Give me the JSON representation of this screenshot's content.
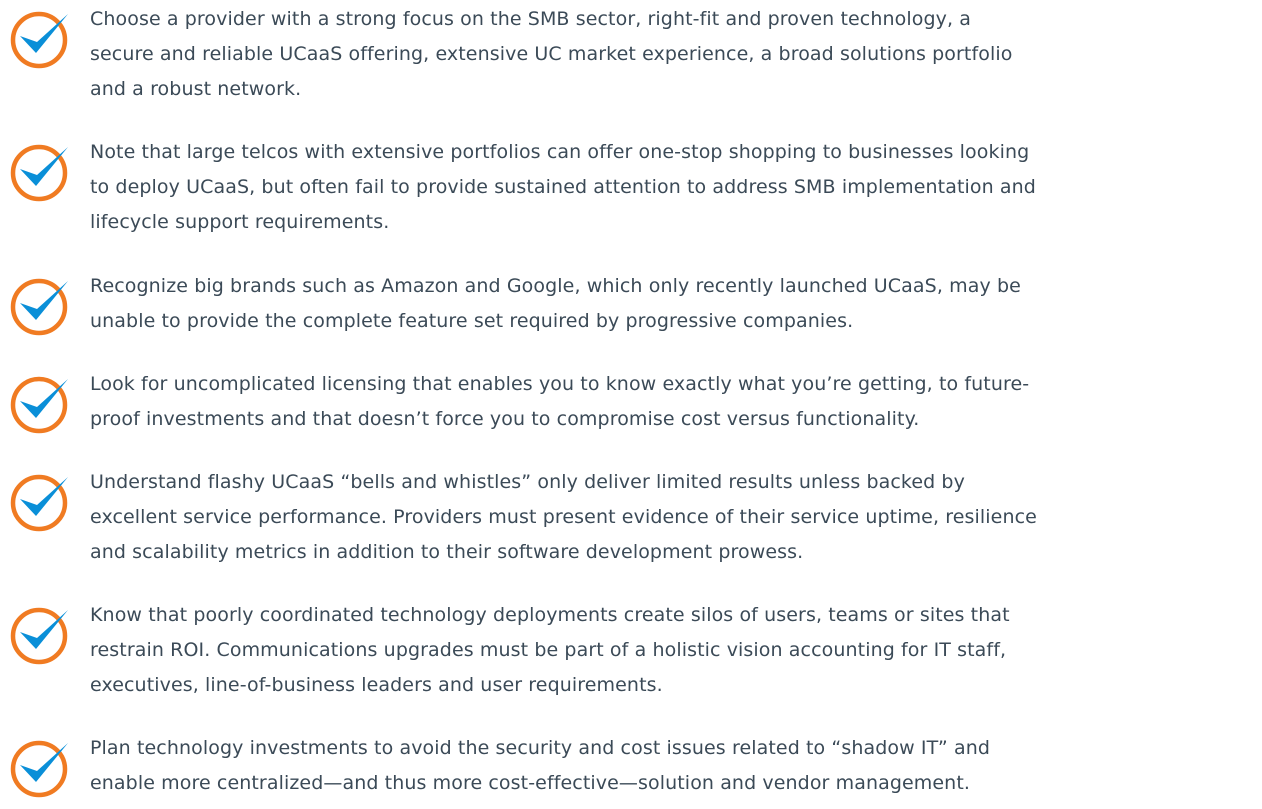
{
  "colors": {
    "circle": "#f07b22",
    "check": "#0a8fd8",
    "text": "#3b4a57"
  },
  "checklist": {
    "items": [
      {
        "icon": "checkmark-circle-icon",
        "lines": [
          "Choose a provider with a strong focus on the SMB sector, right-fit and proven technology, a",
          "secure and reliable UCaaS offering, extensive UC market experience, a broad solutions portfolio",
          "and a robust network."
        ]
      },
      {
        "icon": "checkmark-circle-icon",
        "lines": [
          "Note that large telcos with extensive portfolios can offer one-stop shopping to businesses looking",
          "to deploy UCaaS, but often fail to provide sustained attention to address SMB implementation and",
          "lifecycle support requirements."
        ]
      },
      {
        "icon": "checkmark-circle-icon",
        "lines": [
          "Recognize big brands such as Amazon and Google, which only recently launched UCaaS, may be",
          "unable to provide the complete feature set required by progressive companies."
        ]
      },
      {
        "icon": "checkmark-circle-icon",
        "lines": [
          "Look for uncomplicated licensing that enables you to know exactly what you’re getting, to future-",
          "proof investments and that doesn’t force you to compromise cost versus functionality."
        ]
      },
      {
        "icon": "checkmark-circle-icon",
        "lines": [
          "Understand flashy UCaaS “bells and whistles” only deliver limited results unless backed by",
          "excellent service performance. Providers must present evidence of their service uptime, resilience",
          "and scalability metrics in addition to their software development prowess."
        ]
      },
      {
        "icon": "checkmark-circle-icon",
        "lines": [
          "Know that poorly coordinated technology deployments create silos of users, teams or sites that",
          "restrain ROI. Communications upgrades must be part of a holistic vision accounting for IT staff,",
          "executives, line-of-business leaders and user requirements."
        ]
      },
      {
        "icon": "checkmark-circle-icon",
        "lines": [
          "Plan technology investments to avoid the security and cost issues related to “shadow IT” and",
          "enable more centralized—and thus more cost-effective—solution and vendor management."
        ]
      }
    ]
  }
}
